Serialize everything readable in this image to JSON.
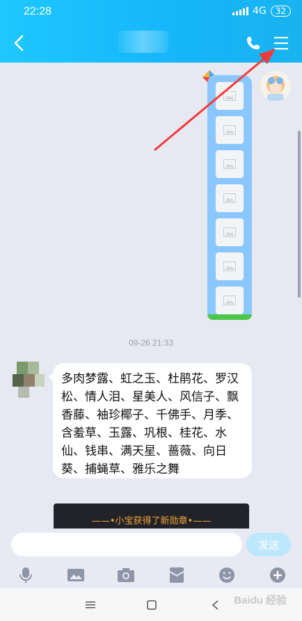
{
  "status_bar": {
    "time": "22:28",
    "network": "4G",
    "battery": "32"
  },
  "header": {
    "back_icon": "chevron-left-icon",
    "phone_icon": "phone-icon",
    "menu_icon": "menu-icon"
  },
  "messages": {
    "timestamp": "09-26 21:33",
    "text": "多肉梦露、虹之玉、杜鹃花、罗汉松、情人泪、星美人、风信子、飘香藤、袖珍椰子、千佛手、月季、含羞草、玉露、巩根、桂花、水仙、钱串、满天星、蔷薇、向日葵、捕蝇草、雅乐之舞",
    "badge_notice": "——•小宝获得了新勋章•——"
  },
  "input": {
    "value": "",
    "send_label": "发送"
  },
  "toolbar": {
    "items": [
      "microphone-icon",
      "image-icon",
      "camera-icon",
      "red-packet-icon",
      "emoji-icon",
      "plus-icon"
    ]
  },
  "nav": {
    "items": [
      "menu-nav-icon",
      "home-nav-icon",
      "back-nav-icon"
    ]
  },
  "watermark": "Baidu 经验",
  "colors": {
    "header": "#16b5f8",
    "bubble_image": "#8bc7ff",
    "send_button": "#bde7fb",
    "annotation_arrow": "#f23a3a"
  }
}
